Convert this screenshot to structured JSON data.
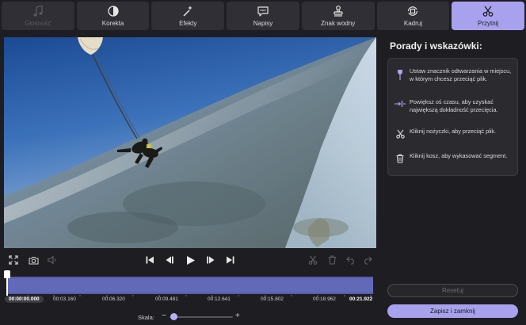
{
  "tabs": [
    {
      "label": "Głośność",
      "icon": "music-note-icon",
      "state": "disabled"
    },
    {
      "label": "Korekta",
      "icon": "contrast-icon",
      "state": "normal"
    },
    {
      "label": "Efekty",
      "icon": "magic-wand-icon",
      "state": "normal"
    },
    {
      "label": "Napisy",
      "icon": "speech-bubble-icon",
      "state": "normal"
    },
    {
      "label": "Znak wodny",
      "icon": "stamp-icon",
      "state": "normal"
    },
    {
      "label": "Kadruj",
      "icon": "crop-rotate-icon",
      "state": "normal"
    },
    {
      "label": "Przytnij",
      "icon": "scissors-icon",
      "state": "active"
    }
  ],
  "tips": {
    "title": "Porady i wskazówki:",
    "items": [
      {
        "icon": "marker-pin-icon",
        "text": "Ustaw znacznik odtwarzania w miejscu, w którym chcesz przeciąć plik."
      },
      {
        "icon": "expand-timeline-icon",
        "text": "Powiększ oś czasu, aby uzyskać największą dokładność przecięcia."
      },
      {
        "icon": "scissors-icon",
        "text": "Kliknij nożyczki, aby przeciąć plik."
      },
      {
        "icon": "trash-icon",
        "text": "Kliknij kosz, aby wykasować segment."
      }
    ]
  },
  "buttons": {
    "reset": "Resetuj",
    "save": "Zapisz i zamknij"
  },
  "timeline": {
    "current_time": "00:00:00.000",
    "ticks": [
      "00:00:00.000",
      "00:03.160",
      "00:06.320",
      "00:09.481",
      "00:12.641",
      "00:15.802",
      "00:18.962",
      "00:21.922"
    ]
  },
  "zoom": {
    "label": "Skala:",
    "minus": "−",
    "plus": "+",
    "level": 0.05
  },
  "colors": {
    "accent": "#a8a2ee",
    "timeline_fill": "#6269b8",
    "background": "#1e1e22",
    "tab_bg": "#2f2f35"
  }
}
